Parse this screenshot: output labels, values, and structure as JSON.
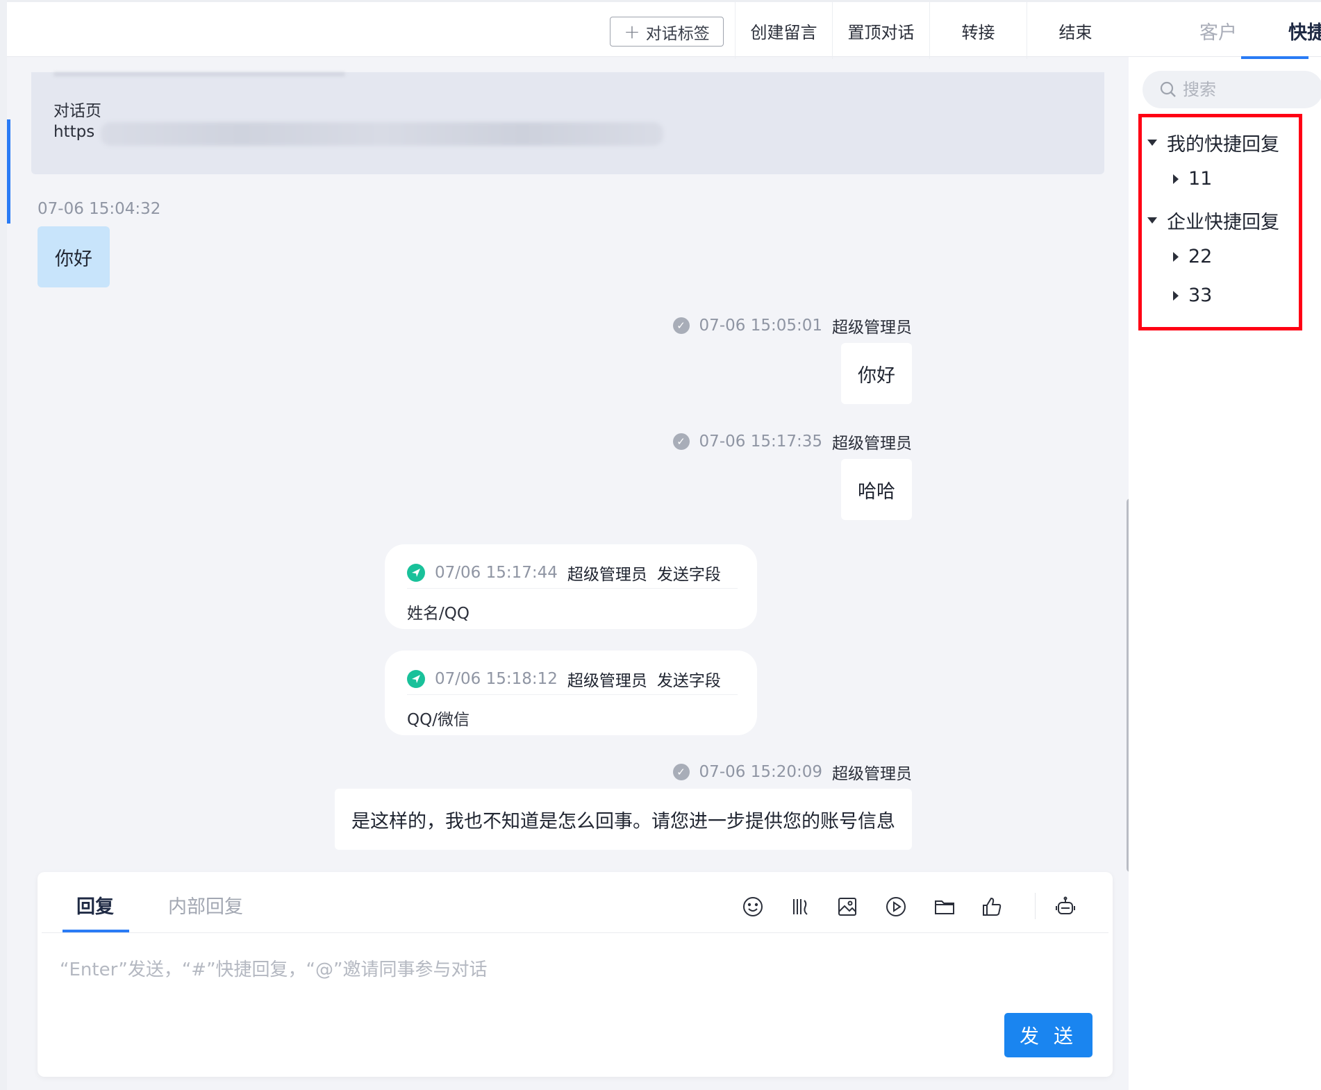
{
  "topbar": {
    "tag_button": "对话标签",
    "actions": [
      "创建留言",
      "置顶对话",
      "转接",
      "结束"
    ]
  },
  "context_card": {
    "label": "对话页",
    "url_prefix": "https"
  },
  "messages": {
    "customer_1": {
      "time": "07-06 15:04:32",
      "text": "你好"
    },
    "agent_1": {
      "time": "07-06 15:05:01",
      "sender": "超级管理员",
      "text": "你好"
    },
    "agent_2": {
      "time": "07-06 15:17:35",
      "sender": "超级管理员",
      "text": "哈哈"
    },
    "field_1": {
      "time": "07/06 15:17:44",
      "sender": "超级管理员",
      "action": "发送字段",
      "text": "姓名/QQ"
    },
    "field_2": {
      "time": "07/06 15:18:12",
      "sender": "超级管理员",
      "action": "发送字段",
      "text": "QQ/微信"
    },
    "agent_3": {
      "time": "07-06 15:20:09",
      "sender": "超级管理员",
      "text": "是这样的，我也不知道是怎么回事。请您进一步提供您的账号信息"
    }
  },
  "composer": {
    "tab_reply": "回复",
    "tab_internal": "内部回复",
    "placeholder": "“Enter”发送，“#”快捷回复，“@”邀请同事参与对话",
    "send_label": "发 送",
    "tools": [
      "emoji-icon",
      "quick-phrase-icon",
      "image-icon",
      "video-icon",
      "folder-icon",
      "thumbs-up-icon",
      "robot-icon"
    ]
  },
  "right_panel": {
    "tab_customer": "客户",
    "tab_quick": "快捷",
    "search_placeholder": "搜索",
    "tree": {
      "my_group": "我的快捷回复",
      "my_items": [
        "11"
      ],
      "company_group": "企业快捷回复",
      "company_items": [
        "22",
        "33"
      ]
    }
  },
  "colors": {
    "accent": "#2a7bf5",
    "send_button": "#1a85f0",
    "customer_bubble": "#c8e4fb",
    "highlight": "#ff0014",
    "field_icon": "#19c19a"
  }
}
